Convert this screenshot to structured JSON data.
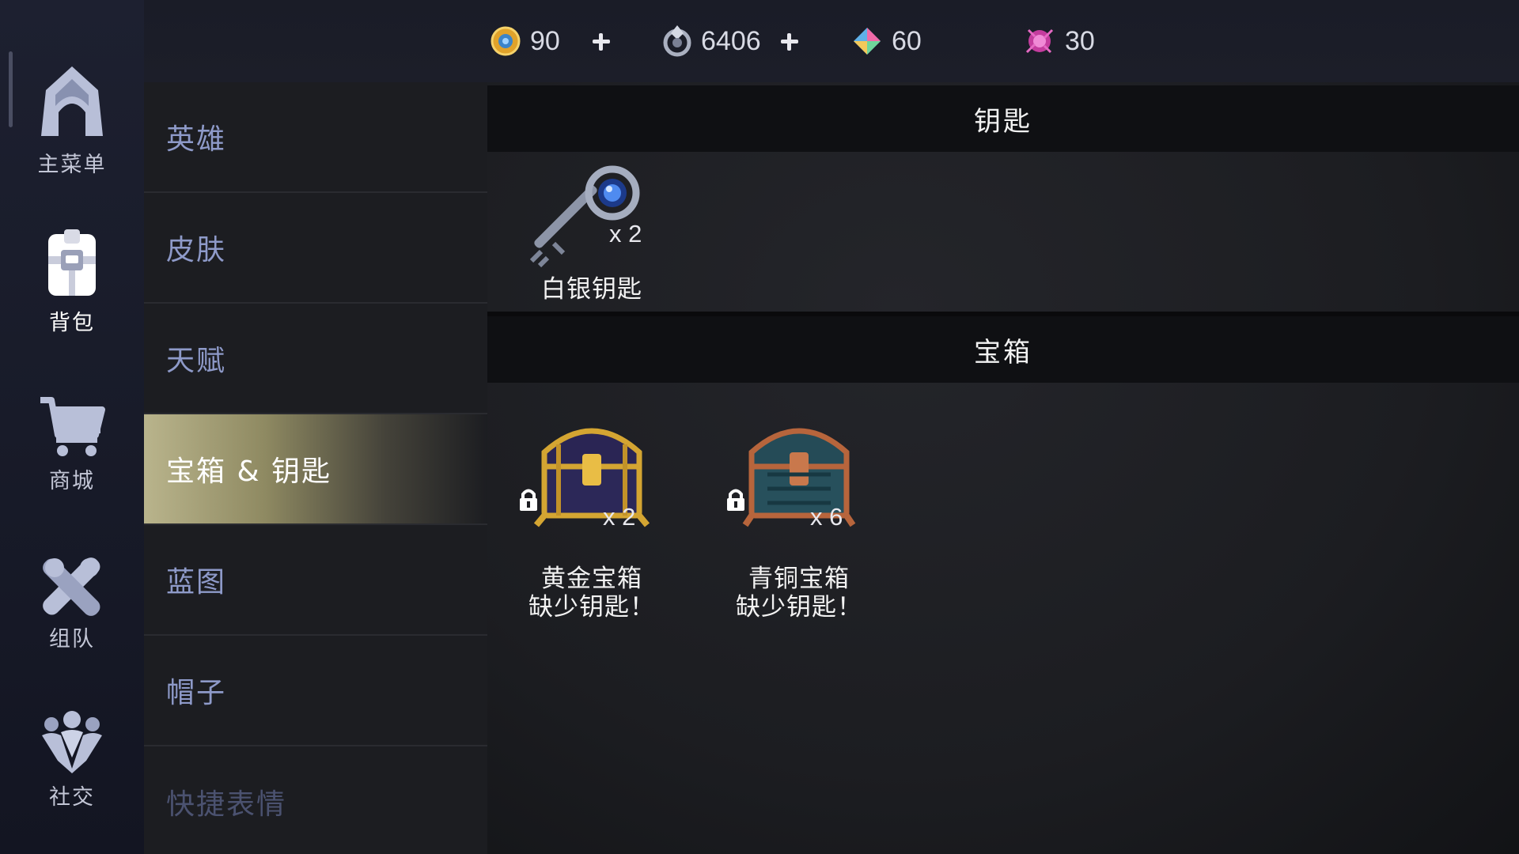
{
  "nav": {
    "items": [
      {
        "label": "主菜单",
        "icon": "castle-icon"
      },
      {
        "label": "背包",
        "icon": "backpack-icon"
      },
      {
        "label": "商城",
        "icon": "cart-icon"
      },
      {
        "label": "组队",
        "icon": "team-icon"
      },
      {
        "label": "社交",
        "icon": "social-icon"
      }
    ],
    "active": "背包"
  },
  "currencies": [
    {
      "name": "gold-coin",
      "value": "90",
      "has_plus": true
    },
    {
      "name": "silver-gem",
      "value": "6406",
      "has_plus": true
    },
    {
      "name": "prism-gem",
      "value": "60",
      "has_plus": false
    },
    {
      "name": "pink-orb",
      "value": "30",
      "has_plus": false
    }
  ],
  "categories": [
    {
      "label": "英雄"
    },
    {
      "label": "皮肤"
    },
    {
      "label": "天赋"
    },
    {
      "label": "宝箱 & 钥匙"
    },
    {
      "label": "蓝图"
    },
    {
      "label": "帽子"
    },
    {
      "label": "快捷表情"
    }
  ],
  "active_category": "宝箱 & 钥匙",
  "keys_section": {
    "title": "钥匙",
    "items": [
      {
        "name": "白银钥匙",
        "qty": "x 2"
      }
    ]
  },
  "chests_section": {
    "title": "宝箱",
    "items": [
      {
        "name": "黄金宝箱",
        "status": "缺少钥匙！",
        "qty": "x 2",
        "locked": true
      },
      {
        "name": "青铜宝箱",
        "status": "缺少钥匙！",
        "qty": "x 6",
        "locked": true
      }
    ]
  },
  "colors": {
    "accent_gold": "#b9b48c",
    "category_text": "#8e9ac9",
    "header_bg": "#0f1013"
  }
}
